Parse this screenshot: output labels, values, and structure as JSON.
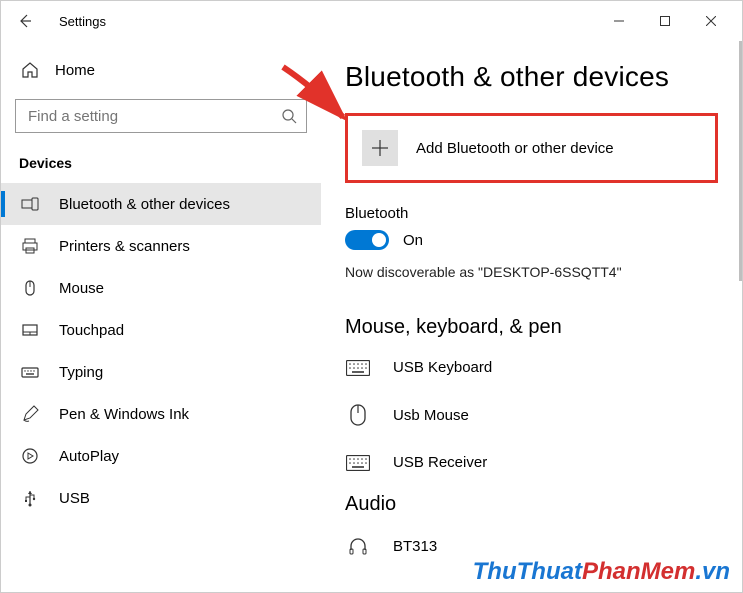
{
  "window": {
    "title": "Settings"
  },
  "sidebar": {
    "home": "Home",
    "search_placeholder": "Find a setting",
    "section": "Devices",
    "items": [
      {
        "label": "Bluetooth & other devices",
        "icon": "bluetooth-devices-icon",
        "active": true
      },
      {
        "label": "Printers & scanners",
        "icon": "printer-icon",
        "active": false
      },
      {
        "label": "Mouse",
        "icon": "mouse-icon",
        "active": false
      },
      {
        "label": "Touchpad",
        "icon": "touchpad-icon",
        "active": false
      },
      {
        "label": "Typing",
        "icon": "keyboard-icon",
        "active": false
      },
      {
        "label": "Pen & Windows Ink",
        "icon": "pen-icon",
        "active": false
      },
      {
        "label": "AutoPlay",
        "icon": "autoplay-icon",
        "active": false
      },
      {
        "label": "USB",
        "icon": "usb-icon",
        "active": false
      }
    ]
  },
  "main": {
    "title": "Bluetooth & other devices",
    "add_device": "Add Bluetooth or other device",
    "bluetooth_label": "Bluetooth",
    "toggle_state": "On",
    "discoverable": "Now discoverable as \"DESKTOP-6SSQTT4\"",
    "sections": [
      {
        "title": "Mouse, keyboard, & pen",
        "devices": [
          {
            "name": "USB Keyboard",
            "icon": "keyboard-device-icon"
          },
          {
            "name": "Usb Mouse",
            "icon": "mouse-device-icon"
          },
          {
            "name": "USB Receiver",
            "icon": "keyboard-device-icon"
          }
        ]
      },
      {
        "title": "Audio",
        "devices": [
          {
            "name": "BT313",
            "icon": "headphone-icon"
          }
        ]
      }
    ]
  },
  "watermark": {
    "part1": "ThuThuat",
    "part2": "PhanMem",
    "part3": ".vn"
  },
  "colors": {
    "accent": "#0078d4",
    "highlight_border": "#e1322a"
  }
}
